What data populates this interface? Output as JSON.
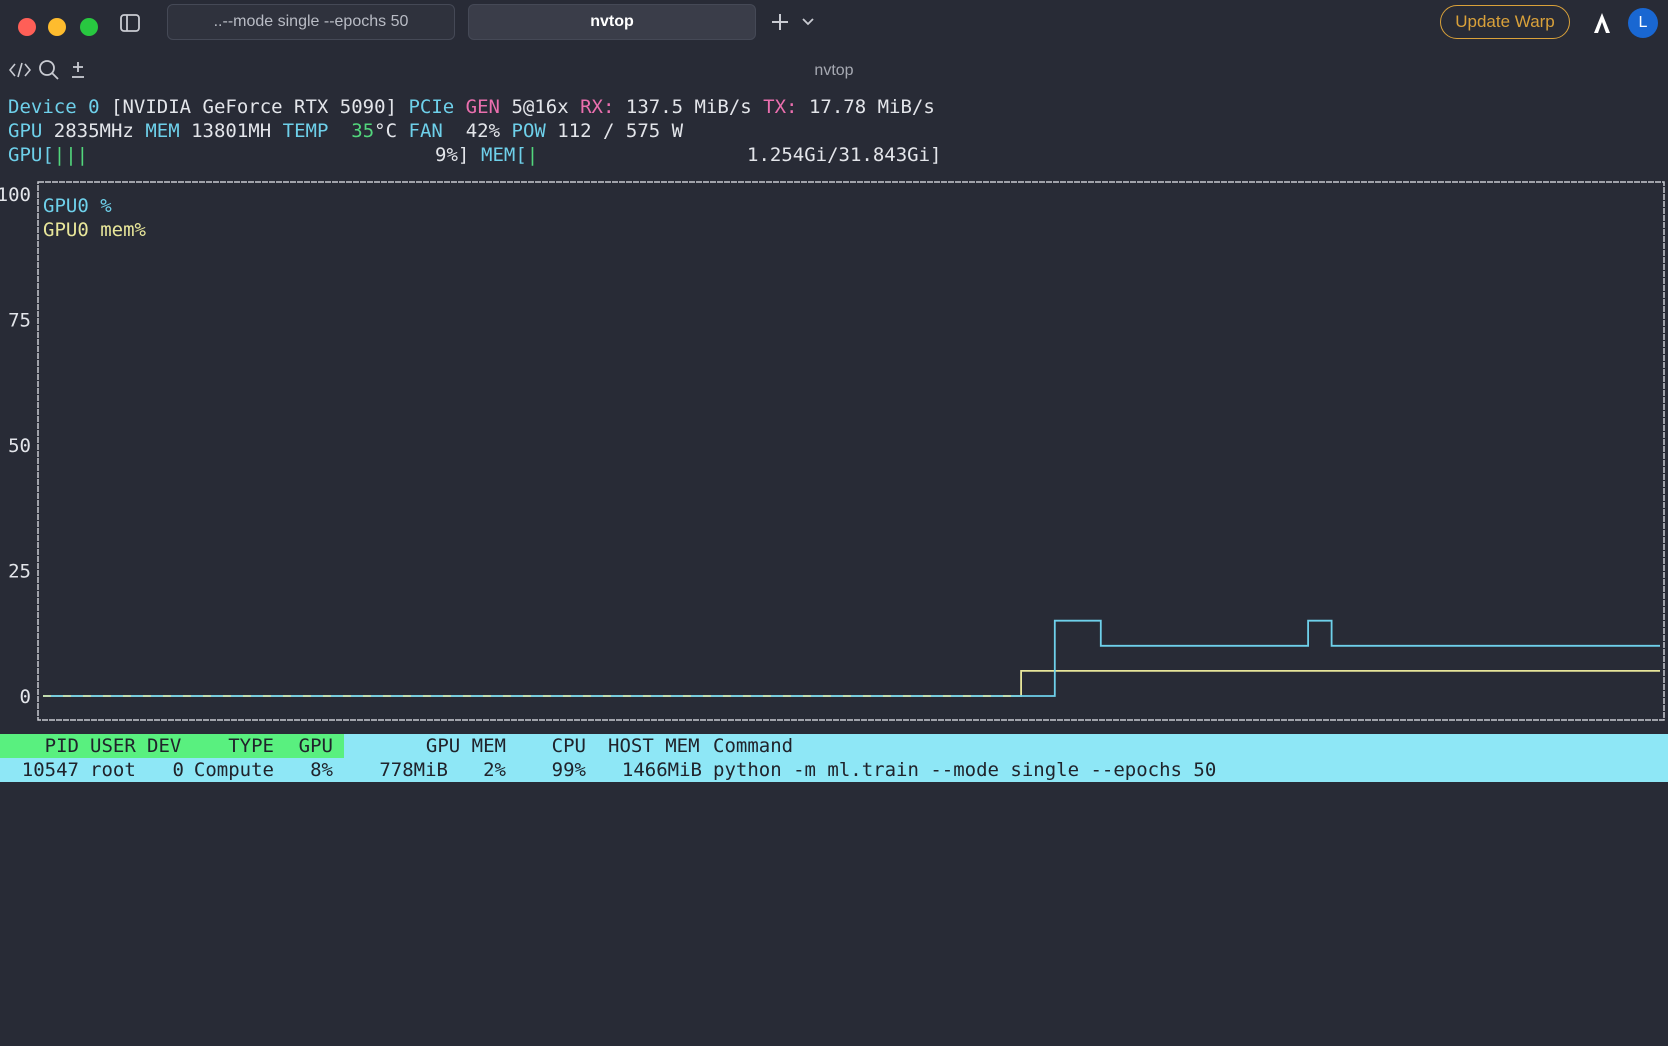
{
  "window": {
    "tabs": [
      {
        "label": "..--mode single --epochs 50",
        "active": false
      },
      {
        "label": "nvtop",
        "active": true
      }
    ],
    "update_button": "Update Warp",
    "avatar_initial": "L",
    "terminal_title": "nvtop"
  },
  "device": {
    "line1": {
      "device_label": "Device",
      "device_index": "0",
      "name": "[NVIDIA GeForce RTX 5090]",
      "pcie_label": "PCIe",
      "gen_label": "GEN",
      "gen_value": "5@16x",
      "rx_label": "RX:",
      "rx_value": "137.5 MiB/s",
      "tx_label": "TX:",
      "tx_value": "17.78 MiB/s"
    },
    "line2": {
      "gpu_label": "GPU",
      "gpu_clock": "2835MHz",
      "mem_label": "MEM",
      "mem_clock": "13801MH",
      "temp_label": "TEMP",
      "temp_value": "35",
      "temp_unit": "°C",
      "fan_label": "FAN",
      "fan_value": "42%",
      "pow_label": "POW",
      "pow_value": "112 / 575 W"
    },
    "line3": {
      "gpu_bar_label": "GPU[",
      "gpu_bar_ticks": "|||",
      "gpu_bar_value": "9%]",
      "gpu_util_percent": 9,
      "mem_bar_label": "MEM[",
      "mem_bar_ticks": "|",
      "mem_bar_value": "1.254Gi/31.843Gi]"
    }
  },
  "chart_data": {
    "type": "line",
    "y_ticks": [
      "100",
      "75",
      "50",
      "25",
      "0"
    ],
    "ylim": [
      0,
      100
    ],
    "x": [
      0,
      1
    ],
    "series": [
      {
        "name": "GPU0 %",
        "color": "#6ed0ea",
        "steps": [
          [
            0.0,
            0
          ],
          [
            0.6257,
            0
          ],
          [
            0.6257,
            15
          ],
          [
            0.6542,
            15
          ],
          [
            0.6542,
            10
          ],
          [
            0.7824,
            10
          ],
          [
            0.7824,
            15
          ],
          [
            0.7969,
            15
          ],
          [
            0.7969,
            10
          ],
          [
            1.0,
            10
          ]
        ]
      },
      {
        "name": "GPU0 mem%",
        "color": "#e8e69a",
        "steps": [
          [
            0.0,
            0
          ],
          [
            0.6049,
            0
          ],
          [
            0.6049,
            5
          ],
          [
            1.0,
            5
          ]
        ]
      }
    ],
    "legend_position": "top-left",
    "grid": false
  },
  "processes": {
    "headers": [
      "PID",
      "USER",
      "DEV",
      "TYPE",
      "GPU",
      "GPU MEM",
      "CPU",
      "HOST MEM",
      "Command"
    ],
    "rows": [
      [
        "10547",
        "root",
        "0",
        "Compute",
        "8%",
        "778MiB",
        "2%",
        "99%",
        "1466MiB",
        "python -m ml.train --mode single --epochs 50"
      ]
    ]
  },
  "colors": {
    "background": "#282b36",
    "cyan": "#6ed0ea",
    "pink": "#ea6fae",
    "green": "#52d67c",
    "yellow": "#e8e69a",
    "header_green": "#59f07f",
    "row_cyan": "#8ee7f6",
    "update_orange": "#d9a13a",
    "avatar_blue": "#1967d2"
  }
}
